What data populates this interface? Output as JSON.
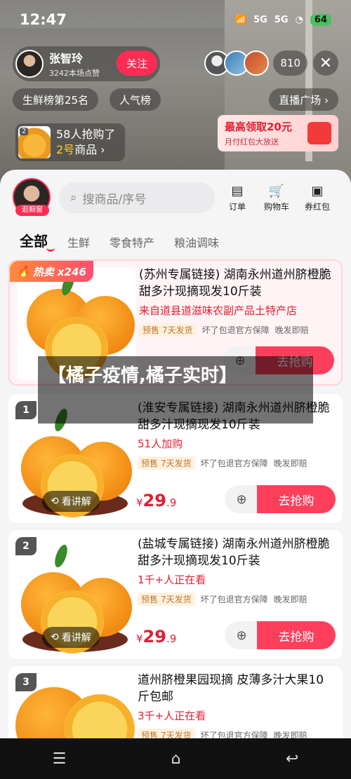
{
  "status": {
    "time": "12:47",
    "net1": "5G",
    "net2": "5G",
    "battery": "64"
  },
  "host": {
    "name": "张智玲",
    "likes": "3242本场点赞",
    "follow": "关注"
  },
  "viewers": {
    "count": "810"
  },
  "chips": {
    "rank": "生鲜榜第25名",
    "popular": "人气榜",
    "plaza": "直播广场 ›"
  },
  "sold": {
    "num": "2",
    "text1": "58人抢购了",
    "text2_hl": "2号",
    "text2": "商品 ›"
  },
  "coupon": {
    "title": "最高领取20元",
    "sub": "月付红包大放送"
  },
  "shop": {
    "tag": "逛橱窗",
    "search_placeholder": "搜商品/序号"
  },
  "tools": [
    {
      "label": "订单"
    },
    {
      "label": "购物车"
    },
    {
      "label": "券红包"
    }
  ],
  "tabs": [
    "全部",
    "生鲜",
    "零食特产",
    "粮油调味"
  ],
  "products": [
    {
      "hot": "热卖 x246",
      "title": "(苏州专属链接) 湖南永州道州脐橙脆甜多汁现摘现发10斤装",
      "sub": "来自道县道滋味农副产品土特产店",
      "tag_pre": "预售",
      "tag_ship": "7天发货",
      "tag2": "坏了包退官方保障",
      "tag3": "晚发即赔",
      "buy": "去抢购"
    },
    {
      "num": "1",
      "title": "(淮安专属链接) 湖南永州道州脐橙脆甜多汁现摘现发10斤装",
      "sub": "51人加购",
      "tag_pre": "预售",
      "tag_ship": "7天发货",
      "tag2": "坏了包退官方保障",
      "tag3": "晚发即赔",
      "explain": "看讲解",
      "price_sym": "¥",
      "price": "29",
      "price_dec": ".9",
      "buy": "去抢购"
    },
    {
      "num": "2",
      "title": "(盐城专属链接) 湖南永州道州脐橙脆甜多汁现摘现发10斤装",
      "sub": "1千+人正在看",
      "tag_pre": "预售",
      "tag_ship": "7天发货",
      "tag2": "坏了包退官方保障",
      "tag3": "晚发即赔",
      "explain": "看讲解",
      "price_sym": "¥",
      "price": "29",
      "price_dec": ".9",
      "buy": "去抢购"
    },
    {
      "num": "3",
      "title": "道州脐橙果园现摘 皮薄多汁大果10斤包邮",
      "sub": "3千+人正在看",
      "tag_pre": "预售",
      "tag_ship": "7天发货",
      "tag2": "坏了包退官方保障",
      "tag3": "晚发即赔"
    }
  ],
  "overlay": "【橘子疫情,橘子实时】"
}
